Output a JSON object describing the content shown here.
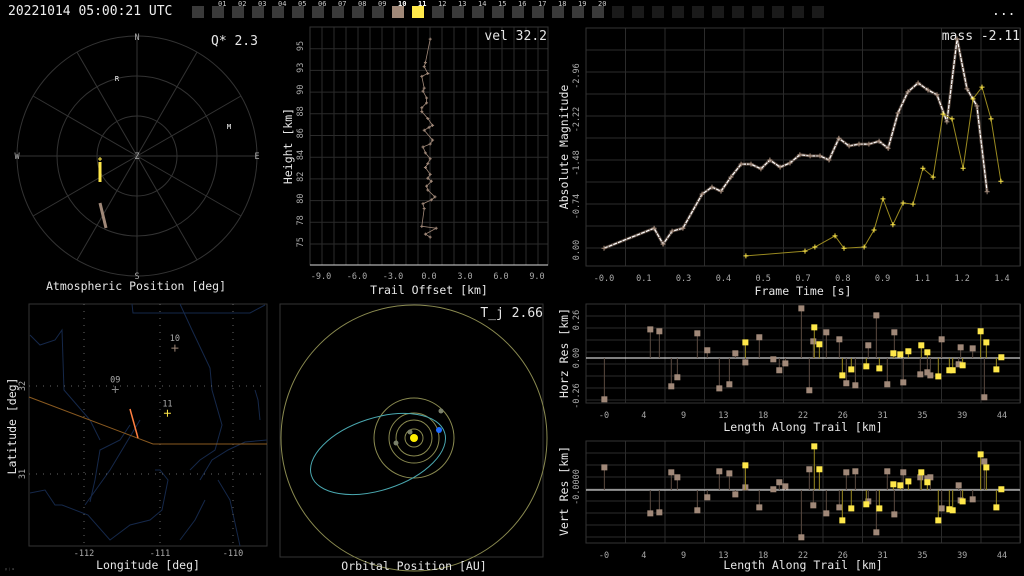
{
  "header": {
    "title": "20221014 05:00:21 UTC",
    "more": "..."
  },
  "frames": {
    "labels": [
      "01",
      "02",
      "03",
      "04",
      "05",
      "06",
      "07",
      "08",
      "09",
      "10",
      "11",
      "12",
      "13",
      "14",
      "15",
      "16",
      "17",
      "18",
      "19",
      "20"
    ],
    "selected": {
      "10": "#a08878",
      "11": "#ffe84a"
    }
  },
  "colors": {
    "station10": "#a08878",
    "station11": "#ffe84a",
    "station09": "#888888",
    "grid": "#2b2b2b",
    "orbit": "#8a8a50",
    "meteor_orbit": "#4aa8b0",
    "earth": "#1e6cff",
    "sun": "#ffee00",
    "river": "#15284a",
    "border": "#8a5a20",
    "trail": "#ff7f40"
  },
  "sky": {
    "title": "Atmospheric Position [deg]",
    "metric": "Q*  2.3",
    "cardinals": {
      "N": "N",
      "S": "S",
      "E": "E",
      "W": "W",
      "Z": "Z"
    },
    "markers": {
      "R": "R",
      "M": "M"
    }
  },
  "height_panel": {
    "metric": "vel 32.2",
    "xlabel": "Trail Offset [km]",
    "ylabel": "Height [km]",
    "xticks": [
      "-9.0",
      "-6.0",
      "-3.0",
      "0.0",
      "3.0",
      "6.0",
      "9.0"
    ],
    "yticks": [
      "95",
      "93",
      "90",
      "88",
      "86",
      "84",
      "82",
      "80",
      "78",
      "75"
    ]
  },
  "light_curve": {
    "metric": "mass -2.11",
    "xlabel": "Frame Time [s]",
    "ylabel": "Absolute Magnitude",
    "xticks": [
      "-0.0",
      "0.1",
      "0.3",
      "0.4",
      "0.5",
      "0.7",
      "0.8",
      "0.9",
      "1.1",
      "1.2",
      "1.4"
    ],
    "yticks": [
      "0.00",
      "-0.74",
      "-1.48",
      "-2.22",
      "-2.96"
    ]
  },
  "horz_res": {
    "xlabel": "Length Along Trail [km]",
    "ylabel": "Horz Res [km]",
    "yticks": [
      "0.26",
      "0.00",
      "-0.26"
    ]
  },
  "vert_res": {
    "xlabel": "Length Along Trail [km]",
    "ylabel": "Vert Res [km]",
    "yticks": [
      "-0.0000"
    ]
  },
  "res_xticks": [
    "-0",
    "4",
    "9",
    "13",
    "18",
    "22",
    "26",
    "31",
    "35",
    "39",
    "44"
  ],
  "map": {
    "xlabel": "Longitude [deg]",
    "ylabel": "Latitude [deg]",
    "xticks": [
      "-112",
      "-111",
      "-110"
    ],
    "yticks": [
      "32",
      "31"
    ],
    "stations": [
      {
        "id": "10",
        "lon": -110.8,
        "lat": 32.43
      },
      {
        "id": "09",
        "lon": -111.6,
        "lat": 31.96
      },
      {
        "id": "11",
        "lon": -110.9,
        "lat": 31.69
      }
    ],
    "corner_mark": "ᵍʲᵚ"
  },
  "orbit": {
    "title": "Orbital Position [AU]",
    "metric": "T_j 2.66"
  },
  "chart_data": [
    {
      "type": "line",
      "title": "Light curve",
      "xlabel": "Frame Time [s]",
      "ylabel": "Absolute Magnitude",
      "xlim": [
        -0.06,
        1.39
      ],
      "ylim": [
        0.27,
        -3.78
      ],
      "series": [
        {
          "name": "10",
          "x": [
            0.0,
            0.167,
            0.197,
            0.227,
            0.263,
            0.327,
            0.36,
            0.39,
            0.423,
            0.457,
            0.49,
            0.523,
            0.553,
            0.587,
            0.62,
            0.653,
            0.687,
            0.72,
            0.75,
            0.783,
            0.817,
            0.85,
            0.883,
            0.917,
            0.947,
            0.98,
            1.013,
            1.047,
            1.08,
            1.11,
            1.143,
            1.177,
            1.21,
            1.243,
            1.277
          ],
          "y": [
            -0.03,
            -0.37,
            -0.1,
            -0.32,
            -0.37,
            -0.95,
            -1.07,
            -1.0,
            -1.24,
            -1.46,
            -1.46,
            -1.38,
            -1.53,
            -1.41,
            -1.48,
            -1.62,
            -1.6,
            -1.6,
            -1.53,
            -1.9,
            -1.77,
            -1.8,
            -1.8,
            -1.85,
            -1.73,
            -2.33,
            -2.69,
            -2.84,
            -2.72,
            -2.64,
            -2.18,
            -3.59,
            -2.74,
            -2.45,
            -0.99
          ]
        },
        {
          "name": "11",
          "x": [
            0.473,
            0.67,
            0.703,
            0.77,
            0.8,
            0.867,
            0.9,
            0.93,
            0.963,
            0.997,
            1.03,
            1.063,
            1.097,
            1.13,
            1.16,
            1.197,
            1.23,
            1.26,
            1.29,
            1.323
          ],
          "y": [
            0.1,
            0.02,
            -0.05,
            -0.24,
            -0.03,
            -0.05,
            -0.34,
            -0.87,
            -0.43,
            -0.8,
            -0.78,
            -1.39,
            -1.24,
            -2.31,
            -2.23,
            -1.39,
            -2.57,
            -2.77,
            -2.23,
            -1.17
          ]
        }
      ]
    },
    {
      "type": "scatter",
      "title": "Residuals",
      "xlabel": "Length Along Trail [km]",
      "xlim": [
        -2,
        46
      ],
      "series": [
        {
          "name": "10",
          "x": [
            0.04,
            5.12,
            6.12,
            7.44,
            8.11,
            10.32,
            11.42,
            12.75,
            13.86,
            14.52,
            15.63,
            17.17,
            18.72,
            19.38,
            20.05,
            21.82,
            22.7,
            23.14,
            24.58,
            26.02,
            26.79,
            27.79,
            29.22,
            30.11,
            31.32,
            32.1,
            33.09,
            34.97,
            35.75,
            36.08,
            37.33,
            39.21,
            39.43,
            40.76,
            42.05
          ],
          "horz": [
            -0.283,
            0.196,
            0.183,
            -0.194,
            -0.132,
            0.169,
            0.053,
            -0.208,
            -0.18,
            0.032,
            -0.03,
            0.142,
            -0.009,
            -0.084,
            -0.037,
            0.34,
            -0.221,
            0.114,
            0.176,
            0.128,
            -0.173,
            -0.187,
            0.087,
            0.292,
            -0.18,
            0.176,
            -0.167,
            -0.112,
            -0.098,
            -0.119,
            0.128,
            -0.043,
            0.073,
            0.066,
            -0.269
          ],
          "vert": [
            0.155,
            -0.16,
            -0.153,
            0.121,
            0.087,
            -0.139,
            -0.05,
            0.128,
            0.114,
            -0.03,
            0.018,
            -0.119,
            0.005,
            0.053,
            0.025,
            -0.324,
            0.142,
            -0.105,
            -0.16,
            -0.119,
            0.121,
            0.128,
            -0.078,
            -0.29,
            0.128,
            -0.167,
            0.121,
            0.087,
            0.08,
            0.087,
            -0.126,
            0.032,
            -0.071,
            -0.064,
            0.196
          ]
        },
        {
          "name": "11",
          "x": [
            15.63,
            23.25,
            23.81,
            26.35,
            27.34,
            29.0,
            30.44,
            31.99,
            32.76,
            33.65,
            35.08,
            35.75,
            36.96,
            38.18,
            38.55,
            39.65,
            41.64,
            42.27,
            43.38,
            43.93
          ],
          "horz": [
            0.107,
            0.21,
            0.094,
            -0.119,
            -0.078,
            -0.057,
            -0.071,
            0.032,
            0.025,
            0.046,
            0.087,
            0.039,
            -0.126,
            -0.084,
            -0.084,
            -0.05,
            0.183,
            0.107,
            -0.078,
            0.005
          ],
          "vert": [
            0.169,
            0.299,
            0.142,
            -0.208,
            -0.126,
            -0.098,
            -0.126,
            0.039,
            0.032,
            0.059,
            0.121,
            0.053,
            -0.208,
            -0.132,
            -0.139,
            -0.078,
            0.244,
            0.155,
            -0.119,
            0.005
          ]
        }
      ]
    },
    {
      "type": "line",
      "title": "Height vs trail offset",
      "xlabel": "Trail Offset [km]",
      "ylabel": "Height [km]",
      "xlim": [
        -10,
        10
      ],
      "ylim": [
        72,
        97.5
      ],
      "x": [
        0.1,
        -0.3,
        -0.4,
        -0.1,
        -0.6,
        -0.4,
        -0.5,
        -0.2,
        -0.2,
        -0.6,
        -0.6,
        -0.1,
        0.3,
        0.0,
        -0.4,
        0.3,
        0.1,
        -0.5,
        -0.3,
        0.1,
        -0.1,
        -0.3,
        0.1,
        -0.1,
        0.2,
        -0.2,
        -0.1,
        0.5,
        0.2,
        -0.5,
        -0.4,
        -0.6,
        0.6,
        -0.3,
        0.1
      ],
      "y": [
        95.7,
        93.3,
        92.9,
        92.2,
        91.9,
        90.7,
        90.4,
        89.7,
        89.2,
        88.7,
        88.3,
        87.6,
        86.9,
        86.7,
        86.4,
        85.4,
        85.0,
        84.7,
        84.1,
        83.5,
        83.0,
        82.6,
        81.9,
        81.5,
        81.2,
        80.7,
        80.3,
        79.6,
        79.3,
        78.9,
        78.4,
        76.6,
        76.4,
        75.8,
        75.5
      ]
    }
  ]
}
